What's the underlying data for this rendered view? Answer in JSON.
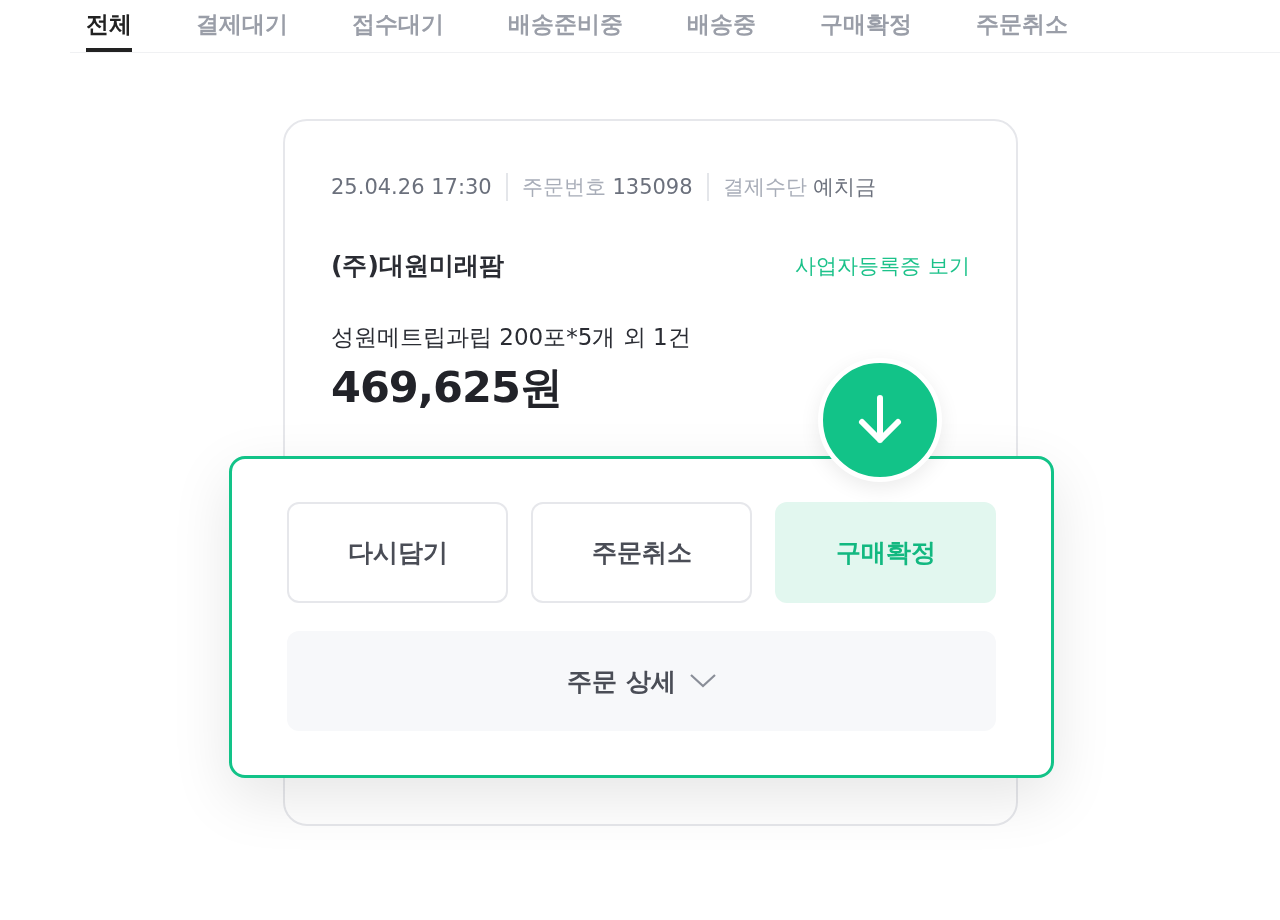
{
  "tabs": [
    {
      "label": "전체",
      "selected": true
    },
    {
      "label": "결제대기",
      "selected": false
    },
    {
      "label": "접수대기",
      "selected": false
    },
    {
      "label": "배송준비중",
      "selected": false
    },
    {
      "label": "배송중",
      "selected": false
    },
    {
      "label": "구매확정",
      "selected": false
    },
    {
      "label": "주문취소",
      "selected": false
    }
  ],
  "order": {
    "date": "25.04.26 17:30",
    "order_number_label": "주문번호",
    "order_number": "135098",
    "payment_label": "결제수단",
    "payment": "예치금",
    "seller": "(주)대원미래팜",
    "business_link": "사업자등록증 보기",
    "product": "성원메트립과립 200포*5개 외 1건",
    "price": "469,625원"
  },
  "actions": [
    {
      "label": "다시담기",
      "kind": "outline"
    },
    {
      "label": "주문취소",
      "kind": "outline"
    },
    {
      "label": "구매확정",
      "kind": "primary"
    }
  ],
  "detail_button": {
    "label": "주문 상세"
  }
}
